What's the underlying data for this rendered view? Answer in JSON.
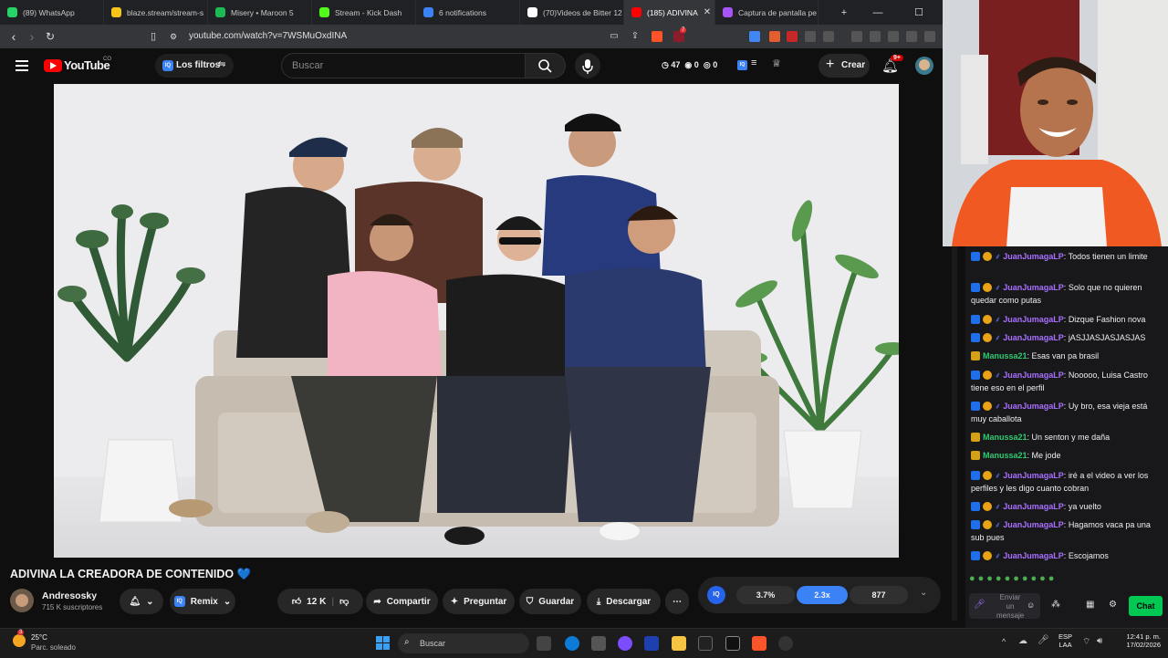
{
  "browser": {
    "tabs": [
      {
        "label": "(89) WhatsApp",
        "color": "#25d366",
        "icon": "whatsapp-icon"
      },
      {
        "label": "blaze.stream/stream-s",
        "color": "#f5c518",
        "icon": "blaze-icon"
      },
      {
        "label": "Misery • Maroon 5",
        "color": "#1db954",
        "icon": "spotify-icon"
      },
      {
        "label": "Stream - Kick Dash",
        "color": "#53fc18",
        "icon": "kick-icon"
      },
      {
        "label": "6 notifications",
        "color": "#3b82f6",
        "icon": "notifications-icon"
      },
      {
        "label": "(70)Videos de Bitter 12",
        "color": "#ffffff",
        "icon": "tiktok-icon"
      },
      {
        "label": "(185) ADIVINA",
        "color": "#ff0000",
        "icon": "youtube-icon",
        "active": true
      },
      {
        "label": "Captura de pantalla pe",
        "color": "#a855f7",
        "icon": "capture-icon"
      }
    ],
    "url": "youtube.com/watch?v=7WSMuOxdINA",
    "brave_badge": "7"
  },
  "youtube": {
    "logo_text": "YouTube",
    "country": "CO",
    "filter_label": "Los filtros",
    "search_placeholder": "Buscar",
    "stats": {
      "views": "47",
      "likes": "0",
      "other": "0"
    },
    "create_label": "Crear",
    "notif_count": "9+"
  },
  "video_meta": {
    "title": "ADIVINA LA CREADORA DE CONTENIDO 💙",
    "channel": "Andresosky",
    "subscribers": "715 K suscriptores",
    "remix_label": "Remix",
    "likes": "12 K",
    "share_label": "Compartir",
    "ask_label": "Preguntar",
    "save_label": "Guardar",
    "download_label": "Descargar",
    "ext_stats": {
      "pct": "3.7%",
      "ratio": "2.3x",
      "count": "877"
    }
  },
  "chat": {
    "messages": [
      {
        "user": "JuanJumagaLP",
        "text": "Todos tienen un limite",
        "badge": "prime",
        "color": "#a970ff"
      },
      {
        "user": "JuanJumagaLP",
        "text": "Solo que no quieren quedar como putas",
        "badge": "prime",
        "color": "#a970ff"
      },
      {
        "user": "JuanJumagaLP",
        "text": "Dizque Fashion nova",
        "badge": "prime",
        "color": "#a970ff"
      },
      {
        "user": "JuanJumagaLP",
        "text": "jASJJASJASJASJAS",
        "badge": "prime",
        "color": "#a970ff"
      },
      {
        "user": "Manussa21",
        "text": "Esas van pa brasil",
        "badge": "crown",
        "color": "#2ecc71"
      },
      {
        "user": "JuanJumagaLP",
        "text": "Nooooo, Luisa Castro tiene eso en el perfil",
        "badge": "prime",
        "color": "#a970ff"
      },
      {
        "user": "JuanJumagaLP",
        "text": "Uy bro, esa vieja está muy caballota",
        "badge": "prime",
        "color": "#a970ff"
      },
      {
        "user": "Manussa21",
        "text": "Un senton y me daña",
        "badge": "crown",
        "color": "#2ecc71"
      },
      {
        "user": "Manussa21",
        "text": "Me jode",
        "badge": "crown",
        "color": "#2ecc71"
      },
      {
        "user": "JuanJumagaLP",
        "text": "iré a el video a ver los perfiles y les digo cuanto cobran",
        "badge": "prime",
        "color": "#a970ff"
      },
      {
        "user": "JuanJumagaLP",
        "text": "ya vuelto",
        "badge": "prime",
        "color": "#a970ff"
      },
      {
        "user": "JuanJumagaLP",
        "text": "Hagamos vaca pa una sub pues",
        "badge": "prime",
        "color": "#a970ff"
      },
      {
        "user": "JuanJumagaLP",
        "text": "Escojamos",
        "badge": "prime",
        "color": "#a970ff"
      }
    ],
    "input_placeholder": "Enviar un mensaje",
    "chat_button": "Chat"
  },
  "taskbar": {
    "weather_temp": "25°C",
    "weather_desc": "Parc. soleado",
    "weather_badge": "3",
    "search_label": "Buscar",
    "lang": "ESP",
    "lang_sub": "LAA",
    "time": "12:41 p. m.",
    "date": "17/02/2026"
  }
}
